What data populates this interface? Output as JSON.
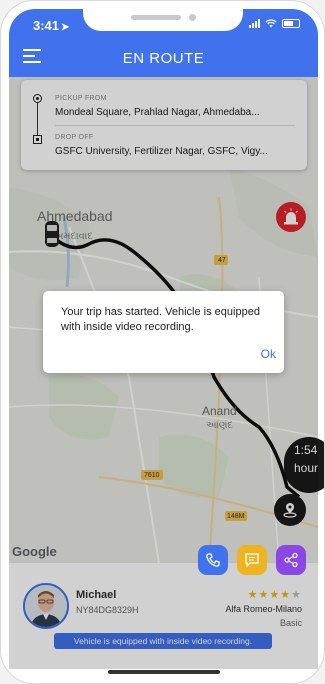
{
  "status_bar": {
    "time": "3:41"
  },
  "header": {
    "title": "EN ROUTE",
    "menu_icon": "hamburger-menu-icon"
  },
  "trip": {
    "pickup_label": "PICKUP FROM",
    "pickup_address": "Mondeal Square, Prahlad Nagar, Ahmedaba...",
    "dropoff_label": "DROP OFF",
    "dropoff_address": "GSFC University, Fertilizer Nagar, GSFC, Vigy..."
  },
  "map": {
    "city_label": "Ahmedabad",
    "city_label_local": "અમદાવાદ",
    "town_anand": "Anand",
    "town_anand_local": "આણંદ",
    "google_logo": "Google",
    "road_47": "47",
    "road_7610": "7610",
    "road_148m": "148M",
    "eta_value": "1:54",
    "eta_unit": "hour"
  },
  "dialog": {
    "message": "Your trip has started. Vehicle is equipped with inside video recording.",
    "ok_label": "Ok"
  },
  "actions": {
    "call_icon": "phone-icon",
    "chat_icon": "chat-icon",
    "share_icon": "share-icon"
  },
  "driver": {
    "name": "Michael",
    "plate": "NY84DG8329H",
    "rating": 4,
    "rating_max": 5,
    "car_model": "Alfa Romeo-Milano",
    "car_class": "Basic",
    "notice": "Vehicle is equipped with inside video recording."
  },
  "colors": {
    "primary": "#3f72ec",
    "sos": "#e2232a",
    "chat": "#f0b320",
    "share": "#8b46e6"
  }
}
